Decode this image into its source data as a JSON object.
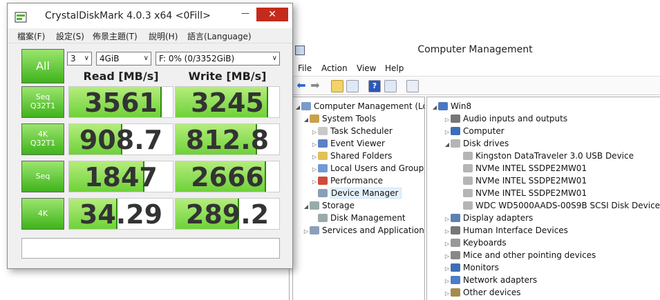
{
  "cm": {
    "title": "Computer Management",
    "menu": [
      "File",
      "Action",
      "View",
      "Help"
    ],
    "tree": [
      {
        "label": "Computer Management (Local",
        "icon": "computer-management-icon",
        "twisty": "◢",
        "indent": 0
      },
      {
        "label": "System Tools",
        "icon": "system-tools-icon",
        "twisty": "◢",
        "indent": 1
      },
      {
        "label": "Task Scheduler",
        "icon": "task-scheduler-icon",
        "twisty": "▷",
        "indent": 2
      },
      {
        "label": "Event Viewer",
        "icon": "event-viewer-icon",
        "twisty": "▷",
        "indent": 2
      },
      {
        "label": "Shared Folders",
        "icon": "shared-folders-icon",
        "twisty": "▷",
        "indent": 2
      },
      {
        "label": "Local Users and Groups",
        "icon": "users-icon",
        "twisty": "▷",
        "indent": 2
      },
      {
        "label": "Performance",
        "icon": "performance-icon",
        "twisty": "▷",
        "indent": 2
      },
      {
        "label": "Device Manager",
        "icon": "device-manager-icon",
        "twisty": "",
        "indent": 2,
        "selected": true
      },
      {
        "label": "Storage",
        "icon": "storage-icon",
        "twisty": "◢",
        "indent": 1
      },
      {
        "label": "Disk Management",
        "icon": "disk-management-icon",
        "twisty": "",
        "indent": 2
      },
      {
        "label": "Services and Applications",
        "icon": "services-icon",
        "twisty": "▷",
        "indent": 1
      }
    ],
    "devices": [
      {
        "label": "Win8",
        "icon": "computer-icon",
        "twisty": "◢",
        "indent": 0
      },
      {
        "label": "Audio inputs and outputs",
        "icon": "speaker-icon",
        "twisty": "▷",
        "indent": 1
      },
      {
        "label": "Computer",
        "icon": "monitor-icon",
        "twisty": "▷",
        "indent": 1
      },
      {
        "label": "Disk drives",
        "icon": "disk-drive-icon",
        "twisty": "◢",
        "indent": 1
      },
      {
        "label": "Kingston DataTraveler 3.0 USB Device",
        "icon": "disk-drive-icon",
        "twisty": "",
        "indent": 2
      },
      {
        "label": "NVMe INTEL SSDPE2MW01",
        "icon": "disk-drive-icon",
        "twisty": "",
        "indent": 2
      },
      {
        "label": "NVMe INTEL SSDPE2MW01",
        "icon": "disk-drive-icon",
        "twisty": "",
        "indent": 2
      },
      {
        "label": "NVMe INTEL SSDPE2MW01",
        "icon": "disk-drive-icon",
        "twisty": "",
        "indent": 2
      },
      {
        "label": "WDC WD5000AADS-00S9B SCSI Disk Device",
        "icon": "disk-drive-icon",
        "twisty": "",
        "indent": 2
      },
      {
        "label": "Display adapters",
        "icon": "display-adapter-icon",
        "twisty": "▷",
        "indent": 1
      },
      {
        "label": "Human Interface Devices",
        "icon": "hid-icon",
        "twisty": "▷",
        "indent": 1
      },
      {
        "label": "Keyboards",
        "icon": "keyboard-icon",
        "twisty": "▷",
        "indent": 1
      },
      {
        "label": "Mice and other pointing devices",
        "icon": "mouse-icon",
        "twisty": "▷",
        "indent": 1
      },
      {
        "label": "Monitors",
        "icon": "monitor-icon",
        "twisty": "▷",
        "indent": 1
      },
      {
        "label": "Network adapters",
        "icon": "network-adapter-icon",
        "twisty": "▷",
        "indent": 1
      },
      {
        "label": "Other devices",
        "icon": "other-devices-icon",
        "twisty": "▷",
        "indent": 1
      }
    ]
  },
  "cdm": {
    "title": "CrystalDiskMark 4.0.3 x64 <0Fill>",
    "close_glyph": "✕",
    "minimize_glyph": "—",
    "menu": [
      "檔案(F)",
      "設定(S)",
      "佈景主題(T)",
      "說明(H)",
      "語言(Language)"
    ],
    "all_label": "All",
    "runs": "3",
    "size": "4GiB",
    "drive": "F: 0% (0/3352GiB)",
    "read_header": "Read [MB/s]",
    "write_header": "Write [MB/s]",
    "rows": [
      {
        "label_line1": "Seq",
        "label_line2": "Q32T1",
        "read": "3561",
        "write": "3245",
        "read_fill": 0.88,
        "write_fill": 0.88
      },
      {
        "label_line1": "4K",
        "label_line2": "Q32T1",
        "read": "908.7",
        "write": "812.8",
        "read_fill": 0.5,
        "write_fill": 0.77
      },
      {
        "label_line1": "Seq",
        "label_line2": "",
        "read": "1847",
        "write": "2666",
        "read_fill": 0.71,
        "write_fill": 0.86
      },
      {
        "label_line1": "4K",
        "label_line2": "",
        "read": "34.29",
        "write": "289.2",
        "read_fill": 0.45,
        "write_fill": 0.6
      }
    ],
    "comment": ""
  },
  "colors": {
    "accent_green": "#3fb31b",
    "bar_green": "#8ee05a",
    "close_red": "#c42b1c"
  }
}
